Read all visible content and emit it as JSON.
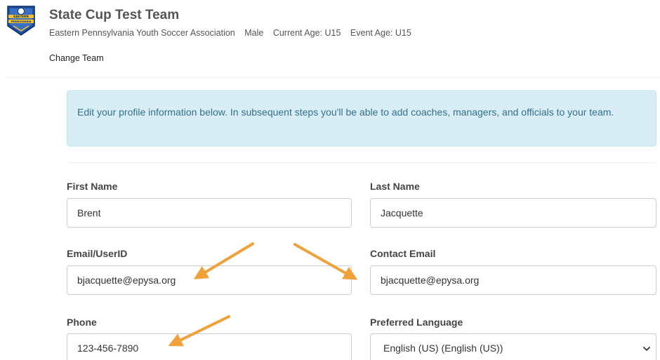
{
  "team": {
    "name": "State Cup Test Team",
    "association": "Eastern Pennsylvania Youth Soccer Association",
    "gender": "Male",
    "current_age": "Current Age: U15",
    "event_age": "Event Age: U15",
    "change_team_label": "Change Team",
    "logo_text_top": "EASTERN",
    "logo_text_bottom": "PENNSYLVANIA"
  },
  "alert": {
    "message": "Edit your profile information below. In subsequent steps you'll be able to add coaches, managers, and officials to your team."
  },
  "form": {
    "first_name": {
      "label": "First Name",
      "value": "Brent"
    },
    "last_name": {
      "label": "Last Name",
      "value": "Jacquette"
    },
    "email_userid": {
      "label": "Email/UserID",
      "value": "bjacquette@epysa.org"
    },
    "contact_email": {
      "label": "Contact Email",
      "value": "bjacquette@epysa.org"
    },
    "phone": {
      "label": "Phone",
      "value": "123-456-7890"
    },
    "preferred_language": {
      "label": "Preferred Language",
      "value": "English (US) (English (US))"
    }
  },
  "colors": {
    "alert_bg": "#d9edf7",
    "alert_text": "#31708f",
    "annotation_arrow": "#f0a13a"
  }
}
